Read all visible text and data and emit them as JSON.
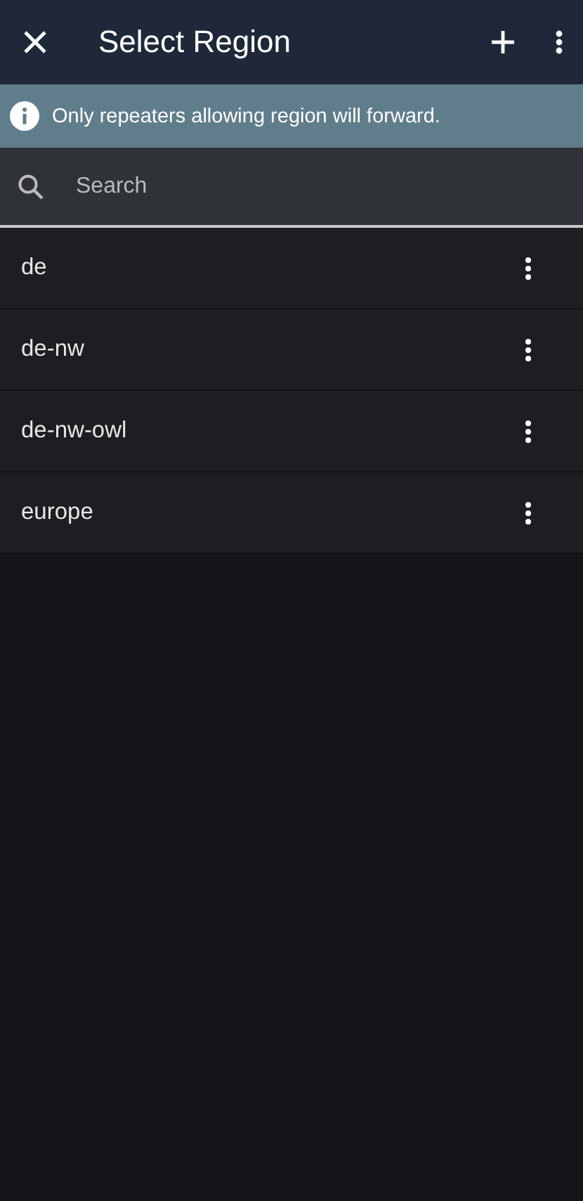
{
  "app_bar": {
    "title": "Select Region"
  },
  "banner": {
    "text": "Only repeaters allowing region will forward."
  },
  "search": {
    "placeholder": "Search"
  },
  "regions": [
    {
      "name": "de"
    },
    {
      "name": "de-nw"
    },
    {
      "name": "de-nw-owl"
    },
    {
      "name": "europe"
    }
  ]
}
